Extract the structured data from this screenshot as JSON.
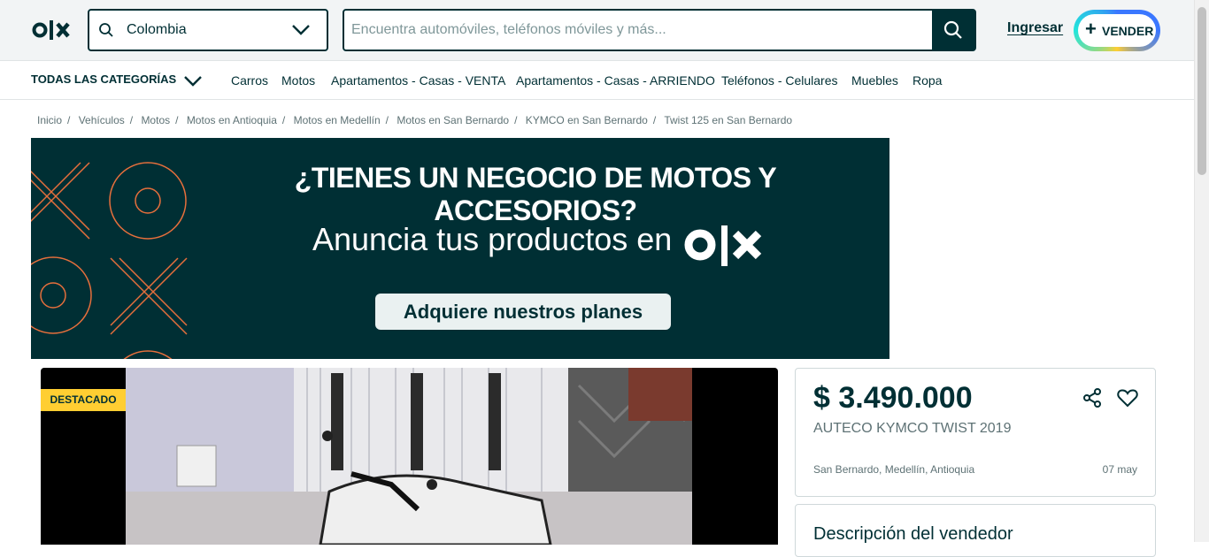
{
  "header": {
    "location": {
      "value": "Colombia"
    },
    "search": {
      "placeholder": "Encuentra automóviles, teléfonos móviles y más..."
    },
    "login_label": "Ingresar",
    "sell_label": "VENDER",
    "colors": {
      "brand": "#002f34",
      "sell_ring": [
        "#ffce32",
        "#23e5db",
        "#3a77ff"
      ]
    }
  },
  "categories": {
    "all_label": "TODAS LAS CATEGORÍAS",
    "items": [
      "Carros",
      "Motos",
      "Apartamentos - Casas - VENTA",
      "Apartamentos - Casas - ARRIENDO",
      "Teléfonos - Celulares",
      "Muebles",
      "Ropa"
    ]
  },
  "breadcrumb": [
    "Inicio",
    "Vehículos",
    "Motos",
    "Motos en Antioquia",
    "Motos en Medellín",
    "Motos en San Bernardo",
    "KYMCO en San Bernardo",
    "Twist 125 en San Bernardo"
  ],
  "banner": {
    "headline": "¿TIENES UN NEGOCIO DE MOTOS Y ACCESORIOS?",
    "subline": "Anuncia tus productos en",
    "cta": "Adquiere nuestros planes"
  },
  "listing": {
    "badge": "DESTACADO",
    "price": "$ 3.490.000",
    "title": "AUTECO KYMCO TWIST 2019",
    "location": "San Bernardo, Medellín, Antioquia",
    "date": "07 may",
    "description_title": "Descripción del vendedor"
  }
}
